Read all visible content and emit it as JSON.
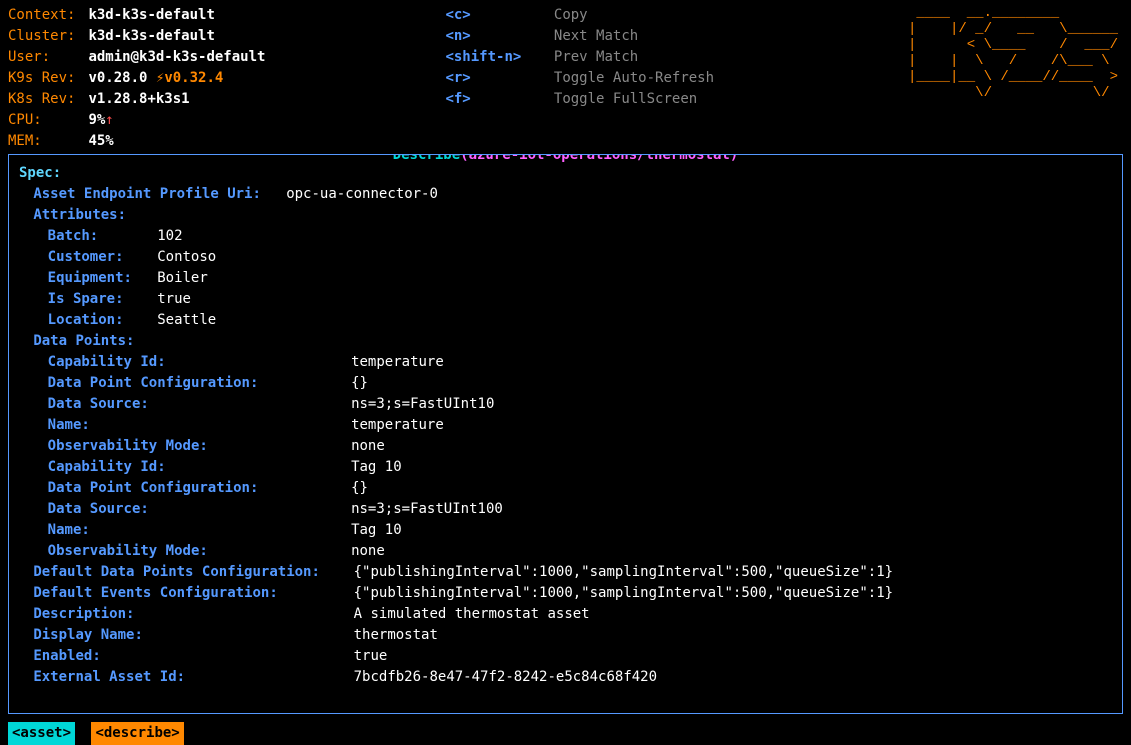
{
  "header": {
    "context_label": "Context:",
    "context": "k3d-k3s-default",
    "cluster_label": "Cluster:",
    "cluster": "k3d-k3s-default",
    "user_label": "User:",
    "user": "admin@k3d-k3s-default",
    "k9s_rev_label": "K9s Rev:",
    "k9s_rev": "v0.28.0",
    "k9s_upgrade": "⚡v0.32.4",
    "k8s_rev_label": "K8s Rev:",
    "k8s_rev": "v1.28.8+k3s1",
    "cpu_label": "CPU:",
    "cpu": "9%",
    "cpu_arrow": "↑",
    "mem_label": "MEM:",
    "mem": "45%"
  },
  "shortcuts": {
    "c_key": "<c>",
    "c_desc": "Copy",
    "n_key": "<n>",
    "n_desc": "Next Match",
    "sn_key": "<shift-n>",
    "sn_desc": "Prev Match",
    "r_key": "<r>",
    "r_desc": "Toggle Auto-Refresh",
    "f_key": "<f>",
    "f_desc": "Toggle FullScreen"
  },
  "ascii_logo": " ____  __.________       \n|    |/ _/   __   \\______\n|      < \\____    /  ___/\n|    |  \\   /    /\\___ \\ \n|____|__ \\ /____//____  >\n        \\/            \\/ ",
  "panel_title": {
    "word": "Describe",
    "open": "(",
    "resource": "azure-iot-operations/thermostat",
    "close": ")"
  },
  "spec": {
    "title": "Spec:",
    "aep_label": "Asset Endpoint Profile Uri:",
    "aep_val": "opc-ua-connector-0",
    "attr_label": "Attributes:",
    "attrs": {
      "batch_label": "Batch:",
      "batch": "102",
      "customer_label": "Customer:",
      "customer": "Contoso",
      "equipment_label": "Equipment:",
      "equipment": "Boiler",
      "spare_label": "Is Spare:",
      "spare": "true",
      "location_label": "Location:",
      "location": "Seattle"
    },
    "dp_label": "Data Points:",
    "dps": [
      {
        "cap_label": "Capability Id:",
        "cap": "temperature",
        "dpc_label": "Data Point Configuration:",
        "dpc": "{}",
        "ds_label": "Data Source:",
        "ds": "ns=3;s=FastUInt10",
        "name_label": "Name:",
        "name": "temperature",
        "obs_label": "Observability Mode:",
        "obs": "none"
      },
      {
        "cap_label": "Capability Id:",
        "cap": "Tag 10",
        "dpc_label": "Data Point Configuration:",
        "dpc": "{}",
        "ds_label": "Data Source:",
        "ds": "ns=3;s=FastUInt100",
        "name_label": "Name:",
        "name": "Tag 10",
        "obs_label": "Observability Mode:",
        "obs": "none"
      }
    ],
    "ddpc_label": "Default Data Points Configuration:",
    "ddpc": "{\"publishingInterval\":1000,\"samplingInterval\":500,\"queueSize\":1}",
    "dec_label": "Default Events Configuration:",
    "dec": "{\"publishingInterval\":1000,\"samplingInterval\":500,\"queueSize\":1}",
    "desc_label": "Description:",
    "desc": "A simulated thermostat asset",
    "disp_label": "Display Name:",
    "disp": "thermostat",
    "enabled_label": "Enabled:",
    "enabled": "true",
    "ext_label": "External Asset Id:",
    "ext": "7bcdfb26-8e47-47f2-8242-e5c84c68f420"
  },
  "breadcrumbs": {
    "asset": "<asset>",
    "describe": "<describe>"
  }
}
